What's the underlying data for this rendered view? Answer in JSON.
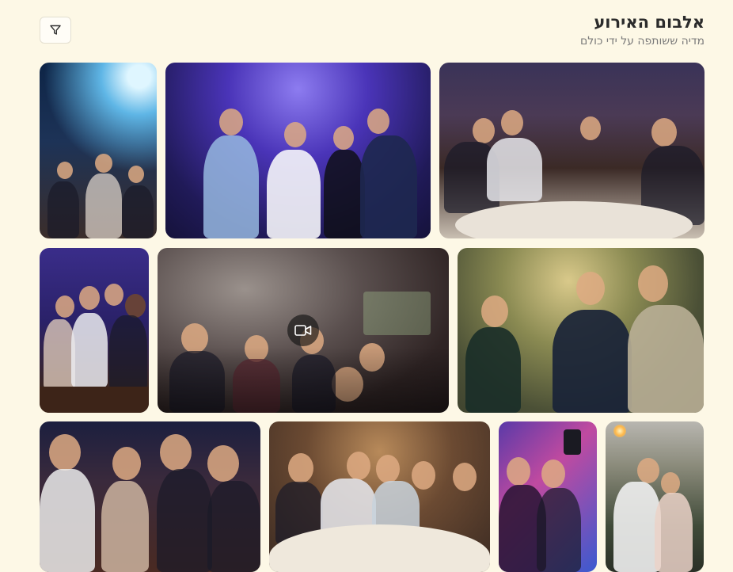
{
  "header": {
    "title": "אלבום האירוע",
    "subtitle": "מדיה ששותפה על ידי כולם"
  },
  "icons": {
    "filter": "filter-icon",
    "video": "video-camera-icon"
  },
  "gallery": {
    "items": [
      {
        "name": "confetti-crowd-photo",
        "type": "photo"
      },
      {
        "name": "dancing-bride-friends-photo",
        "type": "photo"
      },
      {
        "name": "table-toast-photo",
        "type": "photo"
      },
      {
        "name": "bar-shots-group-photo",
        "type": "photo"
      },
      {
        "name": "dance-floor-video",
        "type": "video"
      },
      {
        "name": "garden-conversation-photo",
        "type": "photo"
      },
      {
        "name": "laughing-toast-photo",
        "type": "photo"
      },
      {
        "name": "dinner-table-photo",
        "type": "photo"
      },
      {
        "name": "selfie-photo",
        "type": "photo"
      },
      {
        "name": "sparkler-couple-photo",
        "type": "photo"
      }
    ]
  },
  "colors": {
    "background": "#fdf8e6",
    "title": "#2b2b2b",
    "subtitle": "#7a7a7a"
  }
}
